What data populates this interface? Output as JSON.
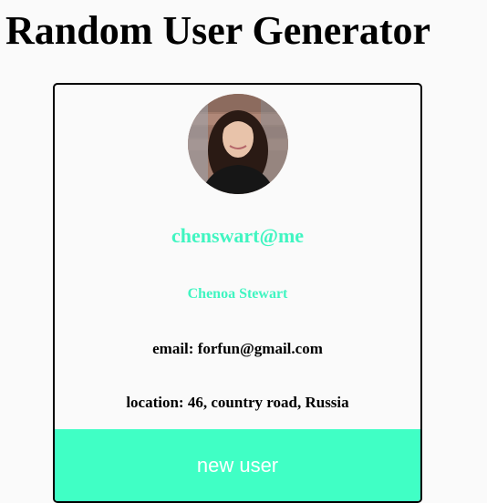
{
  "page": {
    "title": "Random User Generator"
  },
  "user": {
    "username": "chenswart@me",
    "full_name": "Chenoa Stewart",
    "email_label": "email:",
    "email": "forfun@gmail.com",
    "location_label": "location:",
    "location": "46, country road, Russia",
    "avatar_icon": "profile-photo"
  },
  "actions": {
    "new_user_label": "new user"
  },
  "colors": {
    "accent": "#40f5c1",
    "button_bg": "#40ffc5",
    "button_text": "#ffffff",
    "background": "#fafafa",
    "border": "#000000"
  }
}
